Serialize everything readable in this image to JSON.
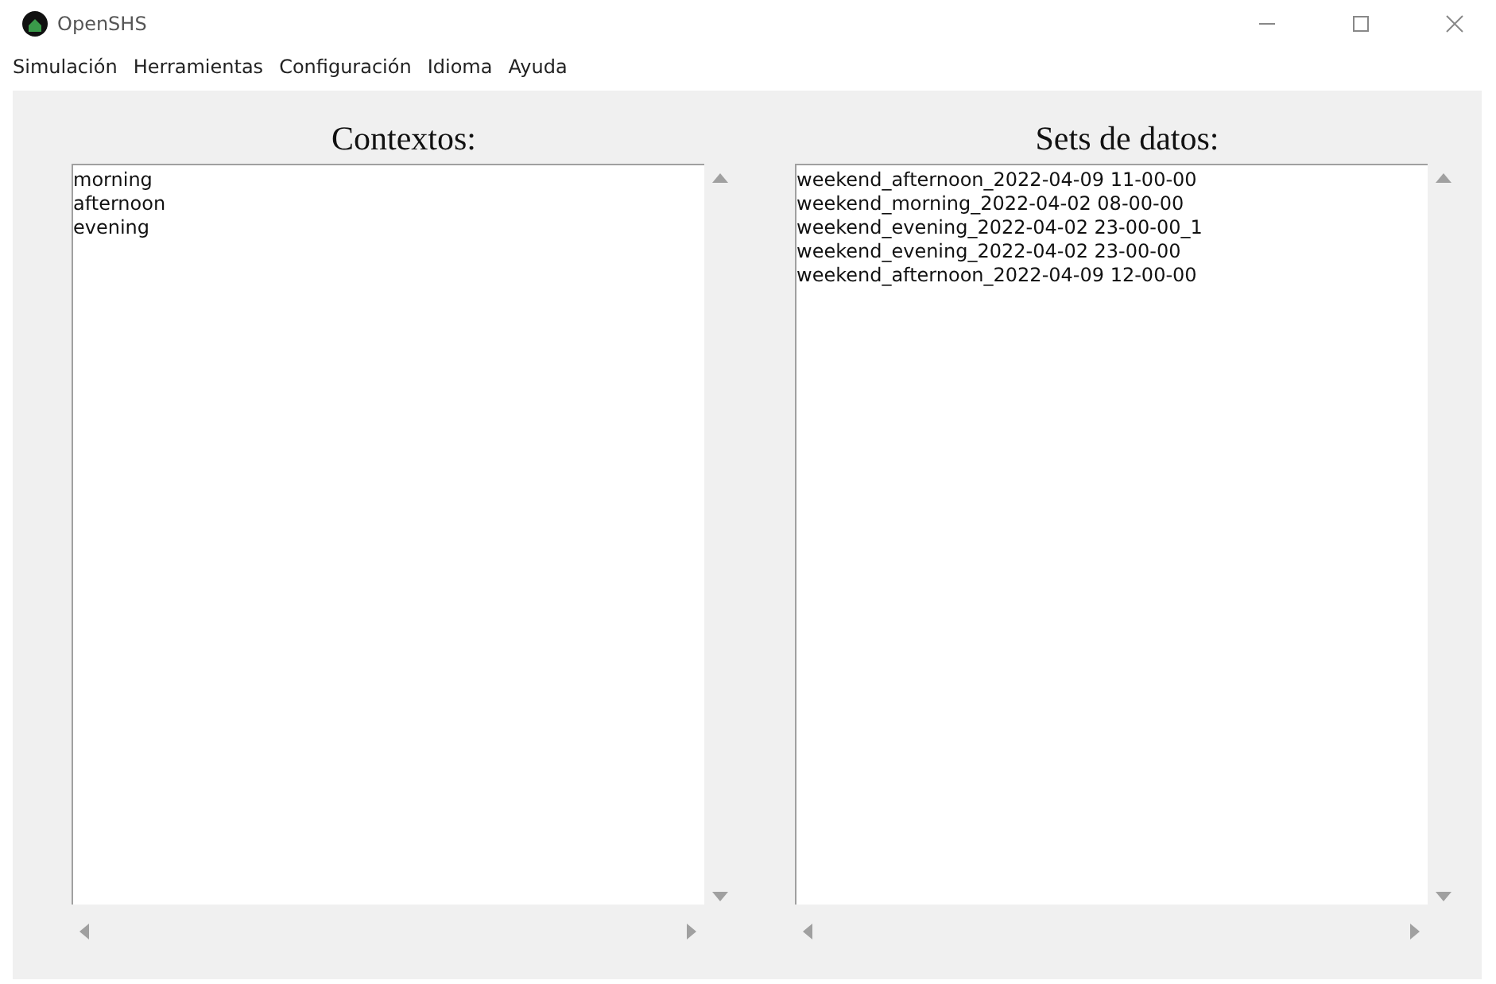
{
  "window": {
    "title": "OpenSHS"
  },
  "menu": [
    "Simulación",
    "Herramientas",
    "Configuración",
    "Idioma",
    "Ayuda"
  ],
  "panels": [
    {
      "heading": "Contextos:",
      "items": [
        "morning",
        "afternoon",
        "evening"
      ]
    },
    {
      "heading": "Sets de datos:",
      "items": [
        "weekend_afternoon_2022-04-09 11-00-00",
        "weekend_morning_2022-04-02 08-00-00",
        "weekend_evening_2022-04-02 23-00-00_1",
        "weekend_evening_2022-04-02 23-00-00",
        "weekend_afternoon_2022-04-09 12-00-00"
      ]
    }
  ]
}
